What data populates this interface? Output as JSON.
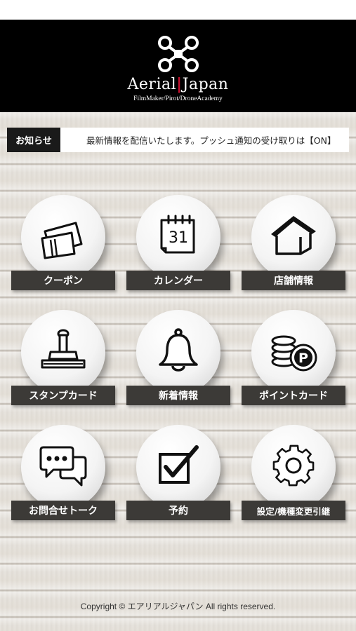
{
  "header": {
    "logo_name_left": "Aerial",
    "logo_separator": "|",
    "logo_name_right": "Japan",
    "logo_tagline": "FilmMaker/Pirot/DroneAcademy"
  },
  "news": {
    "label": "お知らせ",
    "text": "最新情報を配信いたします。プッシュ通知の受け取りは【ON】"
  },
  "menu": [
    {
      "label": "クーポン",
      "icon": "coupon-icon"
    },
    {
      "label": "カレンダー",
      "icon": "calendar-icon",
      "calendar_day": "31"
    },
    {
      "label": "店舗情報",
      "icon": "house-icon"
    },
    {
      "label": "スタンプカード",
      "icon": "stamp-icon"
    },
    {
      "label": "新着情報",
      "icon": "bell-icon"
    },
    {
      "label": "ポイントカード",
      "icon": "coins-icon",
      "coin_letter": "P"
    },
    {
      "label": "お問合せトーク",
      "icon": "chat-icon"
    },
    {
      "label": "予約",
      "icon": "checkbox-icon"
    },
    {
      "label": "設定/機種変更引継",
      "icon": "gear-icon"
    }
  ],
  "footer": {
    "copyright": "Copyright © エアリアルジャパン All rights reserved."
  },
  "colors": {
    "header_bg": "#000000",
    "label_bg": "#3c3a37",
    "logo_accent": "#c8102e"
  }
}
